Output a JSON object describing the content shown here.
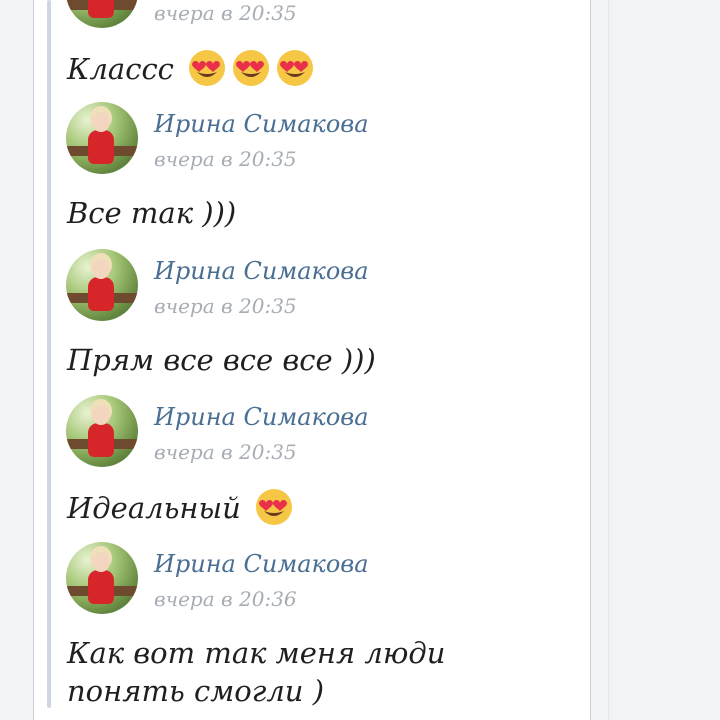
{
  "messages": [
    {
      "author": "",
      "time": "вчера в 20:35",
      "text": "Классс",
      "emoji_count": 3,
      "emoji": "heart-eyes-emoji"
    },
    {
      "author": "Ирина Симакова",
      "time": "вчера в 20:35",
      "text": "Все так )))"
    },
    {
      "author": "Ирина Симакова",
      "time": "вчера в 20:35",
      "text": "Прям все все все )))"
    },
    {
      "author": "Ирина Симакова",
      "time": "вчера в 20:35",
      "text": "Идеальный",
      "emoji_count": 1,
      "emoji": "heart-eyes-emoji"
    },
    {
      "author": "Ирина Симакова",
      "time": "вчера в 20:36",
      "text": "Как вот так меня люди понять смогли )"
    }
  ],
  "colors": {
    "author_name": "#4a6f93",
    "timestamp": "#a7adb4",
    "message_text": "#1f1f1f",
    "quote_bar": "#cfd8e2",
    "dress": "#d7262a"
  }
}
